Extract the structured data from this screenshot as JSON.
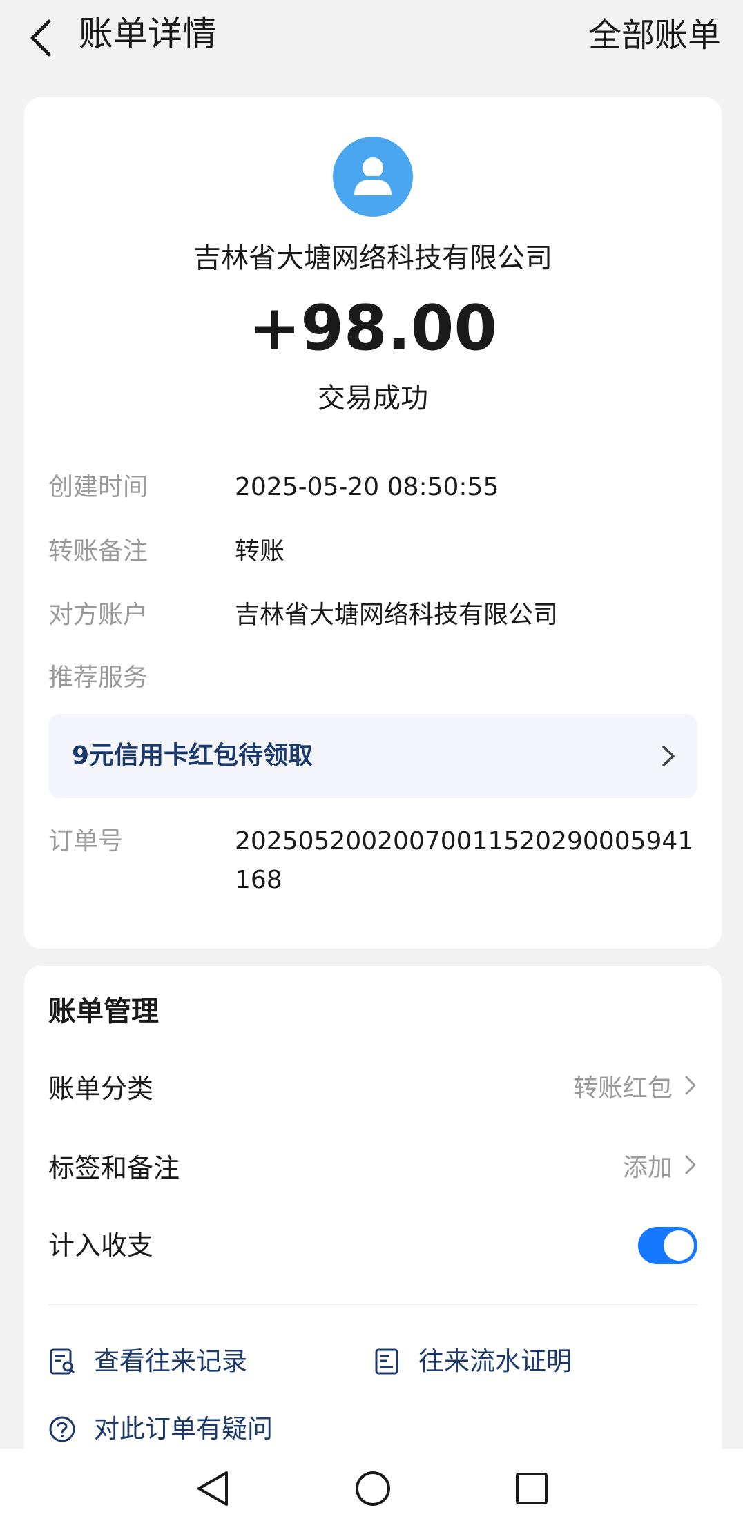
{
  "header": {
    "title": "账单详情",
    "right_link": "全部账单"
  },
  "detail": {
    "avatar_icon": "user-avatar-icon",
    "merchant_name": "吉林省大塘网络科技有限公司",
    "amount": "+98.00",
    "status": "交易成功",
    "rows": [
      {
        "label": "创建时间",
        "value": "2025-05-20 08:50:55"
      },
      {
        "label": "转账备注",
        "value": "转账"
      },
      {
        "label": "对方账户",
        "value": "吉林省大塘网络科技有限公司"
      },
      {
        "label": "推荐服务",
        "value": ""
      }
    ],
    "promo": {
      "text": "9元信用卡红包待领取"
    },
    "order": {
      "label": "订单号",
      "value": "20250520020070011520290005941168"
    }
  },
  "manage": {
    "title": "账单管理",
    "category": {
      "label": "账单分类",
      "value": "转账红包"
    },
    "tags": {
      "label": "标签和备注",
      "value": "添加"
    },
    "include": {
      "label": "计入收支",
      "enabled": true
    },
    "links": {
      "history": "查看往来记录",
      "statement": "往来流水证明",
      "question": "对此订单有疑问"
    }
  },
  "colors": {
    "accent": "#1677ff",
    "avatar": "#4aa6ee",
    "link_text": "#1b3a6b",
    "background": "#f2f2f2"
  }
}
